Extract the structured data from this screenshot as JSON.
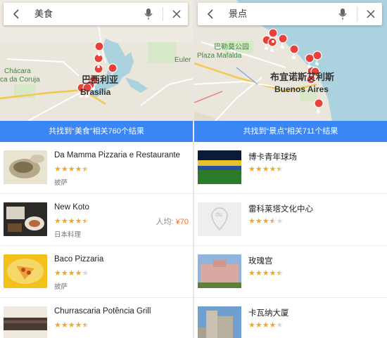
{
  "left": {
    "search": {
      "query": "美食",
      "back_icon": "back-arrow-icon",
      "mic_icon": "microphone-icon",
      "close_icon": "close-icon"
    },
    "map": {
      "labels": {
        "chacara": "Chácara",
        "coruja": "ca da Coruja",
        "euler": "Euler I",
        "city_cn": "巴西利亚",
        "city_en": "Brasília"
      }
    },
    "result_text": "共找到“美食”相关760个结果",
    "items": [
      {
        "name": "Da Mamma Pizzaria e Restaurante",
        "rating": 4.5,
        "tag": "披萨",
        "price_label": "",
        "price_value": ""
      },
      {
        "name": "New Koto",
        "rating": 4.5,
        "tag": "日本料理",
        "price_label": "人均: ",
        "price_value": "¥70"
      },
      {
        "name": "Baco Pizzaria",
        "rating": 4,
        "tag": "披萨",
        "price_label": "",
        "price_value": ""
      },
      {
        "name": "Churrascaria Potência Grill",
        "rating": 4.5,
        "tag": "",
        "price_label": "",
        "price_value": ""
      }
    ]
  },
  "right": {
    "search": {
      "query": "景点",
      "back_icon": "back-arrow-icon",
      "mic_icon": "microphone-icon",
      "close_icon": "close-icon"
    },
    "map": {
      "labels": {
        "park_cn": "巴勒莫公园",
        "plaza": "Plaza Mafalda",
        "city_cn": "布宜诺斯艾利斯",
        "city_en": "Buenos Aires"
      }
    },
    "result_text": "共找到“景点”相关711个结果",
    "items": [
      {
        "name": "博卡青年球场",
        "rating": 4.5
      },
      {
        "name": "雷科莱塔文化中心",
        "rating": 3.5,
        "placeholder": "du"
      },
      {
        "name": "玫瑰宫",
        "rating": 4.5
      },
      {
        "name": "卡瓦纳大厦",
        "rating": 4
      }
    ]
  },
  "colors": {
    "accent": "#3a86f5",
    "star": "#f5a623",
    "price": "#ff6a2a",
    "pin": "#e8413a"
  }
}
